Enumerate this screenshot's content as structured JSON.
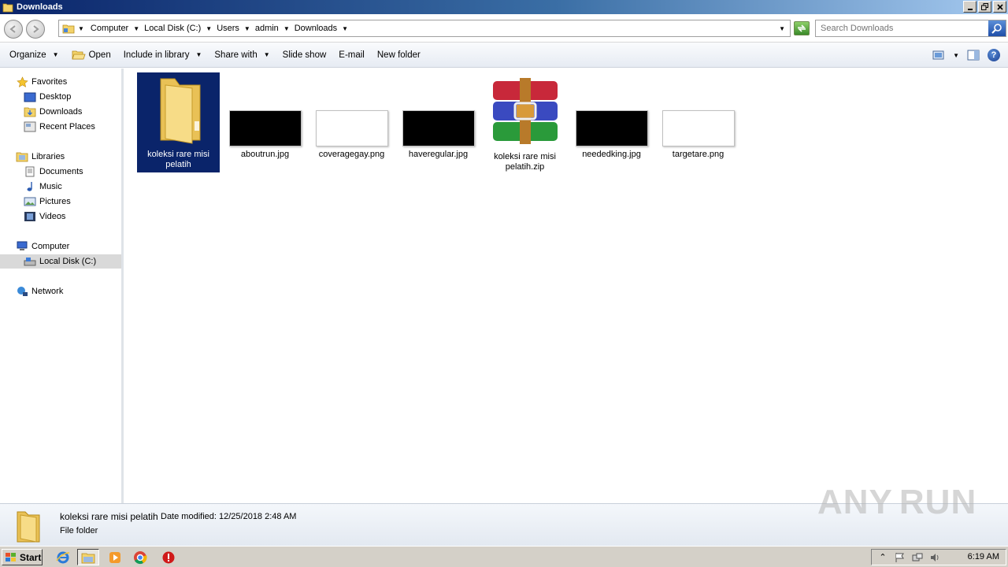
{
  "window": {
    "title": "Downloads"
  },
  "address": {
    "crumbs": [
      "Computer",
      "Local Disk (C:)",
      "Users",
      "admin",
      "Downloads"
    ]
  },
  "search": {
    "placeholder": "Search Downloads"
  },
  "toolbar": {
    "organize": "Organize",
    "open": "Open",
    "include_in_library": "Include in library",
    "share_with": "Share with",
    "slide_show": "Slide show",
    "email": "E-mail",
    "new_folder": "New folder"
  },
  "nav": {
    "favorites": "Favorites",
    "desktop": "Desktop",
    "downloads": "Downloads",
    "recent_places": "Recent Places",
    "libraries": "Libraries",
    "documents": "Documents",
    "music": "Music",
    "pictures": "Pictures",
    "videos": "Videos",
    "computer": "Computer",
    "local_disk": "Local Disk (C:)",
    "network": "Network"
  },
  "files": [
    {
      "name": "koleksi rare misi pelatih",
      "kind": "folder"
    },
    {
      "name": "aboutrun.jpg",
      "kind": "dark-thumb"
    },
    {
      "name": "coveragegay.png",
      "kind": "light-thumb"
    },
    {
      "name": "haveregular.jpg",
      "kind": "dark-thumb"
    },
    {
      "name": "koleksi rare misi pelatih.zip",
      "kind": "winrar"
    },
    {
      "name": "neededking.jpg",
      "kind": "dark-thumb"
    },
    {
      "name": "targetare.png",
      "kind": "light-thumb"
    }
  ],
  "details": {
    "name": "koleksi rare misi pelatih",
    "date_label": "Date modified:",
    "date_value": "12/25/2018 2:48 AM",
    "type": "File folder"
  },
  "taskbar": {
    "start": "Start",
    "clock": "6:19 AM"
  },
  "watermark": {
    "left": "ANY",
    "right": "RUN"
  }
}
